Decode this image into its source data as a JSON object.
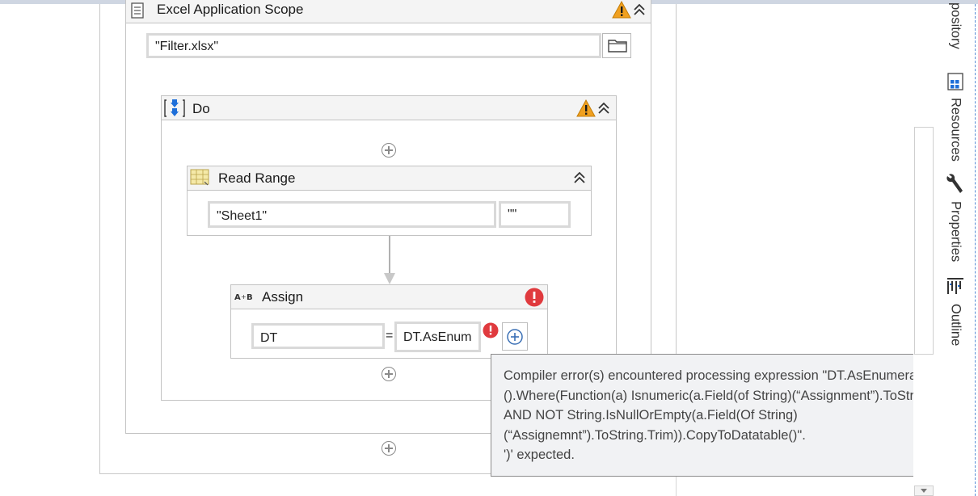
{
  "excel_scope": {
    "title": "Excel Application Scope",
    "workbook_path": "\"Filter.xlsx\"",
    "has_warning": true
  },
  "do_sequence": {
    "title": "Do",
    "has_warning": true
  },
  "read_range": {
    "title": "Read Range",
    "sheet_name": "\"Sheet1\"",
    "range": "\"\""
  },
  "assign": {
    "title": "Assign",
    "has_error": true,
    "to": "DT",
    "operator": "=",
    "value": "DT.AsEnum"
  },
  "error_tooltip": {
    "lines": [
      "Compiler error(s) encountered processing expression \"DT.AsEnumerable",
      "().Where(Function(a) Isnumeric(a.Field(of String)(“Assignment”).ToString",
      "AND NOT String.IsNullOrEmpty(a.Field(Of String)",
      "(“Assignemnt”).ToString.Trim)).CopyToDatatable()\".",
      "')' expected."
    ]
  },
  "right_panel": {
    "tabs": [
      {
        "label": "pository",
        "icon": "repository-icon"
      },
      {
        "label": "Resources",
        "icon": "resources-icon"
      },
      {
        "label": "Properties",
        "icon": "wrench-icon"
      },
      {
        "label": "Outline",
        "icon": "outline-icon"
      }
    ]
  },
  "colors": {
    "warning": "#f0a020",
    "error": "#e03a3e",
    "accent": "#1e6fd9"
  }
}
